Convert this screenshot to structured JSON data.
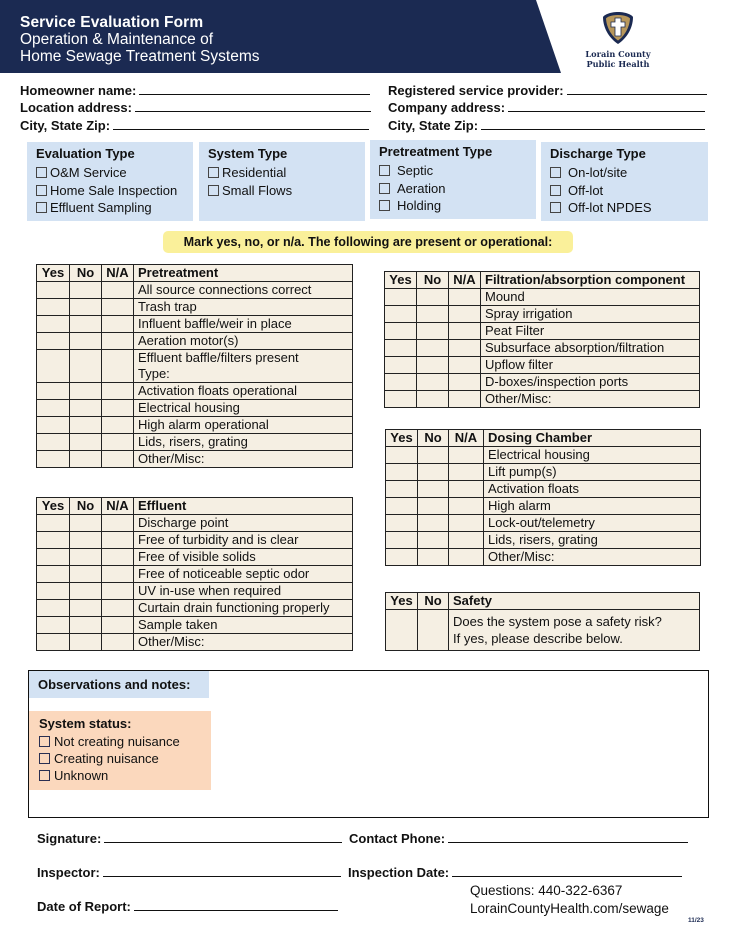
{
  "header": {
    "title": "Service Evaluation Form",
    "subtitle_line1": "Operation & Maintenance of",
    "subtitle_line2": "Home Sewage Treatment Systems",
    "band_color": "#1b2a52",
    "logo": {
      "icon": "shield-cross-icon",
      "name_line1": "Lorain County",
      "name_line2": "Public Health",
      "gold": "#b8975a"
    }
  },
  "info_fields": {
    "left": [
      "Homeowner name:",
      "Location address:",
      "City, State Zip:"
    ],
    "right": [
      "Registered service provider:",
      "Company address:",
      "City, State Zip:"
    ]
  },
  "categories": [
    {
      "title": "Evaluation Type",
      "options": [
        "O&M Service",
        "Home Sale Inspection",
        "Effluent Sampling"
      ]
    },
    {
      "title": "System Type",
      "options": [
        "Residential",
        "Small Flows"
      ]
    },
    {
      "title": "Pretreatment Type",
      "options": [
        "Septic",
        "Aeration",
        "Holding"
      ]
    },
    {
      "title": "Discharge Type",
      "options": [
        "On-lot/site",
        "Off-lot",
        "Off-lot NPDES"
      ]
    }
  ],
  "banner": "Mark yes, no, or n/a. The following are present or operational:",
  "columns": {
    "yes": "Yes",
    "no": "No",
    "na": "N/A"
  },
  "tables": {
    "pretreatment": {
      "title": "Pretreatment",
      "rows": [
        "All source connections correct",
        "Trash trap",
        "Influent baffle/weir in place",
        "Aeration motor(s)",
        "Effluent baffle/filters present",
        "Activation floats operational",
        "Electrical housing",
        "High alarm operational",
        "Lids, risers, grating",
        "Other/Misc:"
      ],
      "effluent_type_label": "Type:"
    },
    "filtration": {
      "title": "Filtration/absorption component",
      "rows": [
        "Mound",
        "Spray irrigation",
        "Peat Filter",
        "Subsurface absorption/filtration",
        "Upflow filter",
        "D-boxes/inspection ports",
        "Other/Misc:"
      ]
    },
    "effluent": {
      "title": "Effluent",
      "rows": [
        "Discharge point",
        "Free of turbidity and is clear",
        "Free of visible solids",
        "Free of noticeable septic odor",
        "UV in-use when required",
        "Curtain drain functioning properly",
        "Sample taken",
        "Other/Misc:"
      ]
    },
    "dosing": {
      "title": "Dosing Chamber",
      "rows": [
        "Electrical housing",
        "Lift pump(s)",
        "Activation floats",
        "High alarm",
        "Lock-out/telemetry",
        "Lids, risers, grating",
        "Other/Misc:"
      ]
    },
    "safety": {
      "title": "Safety",
      "question_line1": "Does the system pose a safety risk?",
      "question_line2": "If yes, please describe below."
    }
  },
  "observations": {
    "label": "Observations and notes:",
    "status_title": "System status:",
    "status_options": [
      "Not creating nuisance",
      "Creating nuisance",
      "Unknown"
    ]
  },
  "bottom_fields": {
    "signature": "Signature:",
    "contact_phone": "Contact Phone:",
    "inspector": "Inspector:",
    "inspection_date": "Inspection Date:",
    "date_of_report": "Date of Report:"
  },
  "contact": {
    "questions": "Questions: 440-322-6367",
    "website": "LorainCountyHealth.com/sewage"
  },
  "version": "11/23"
}
